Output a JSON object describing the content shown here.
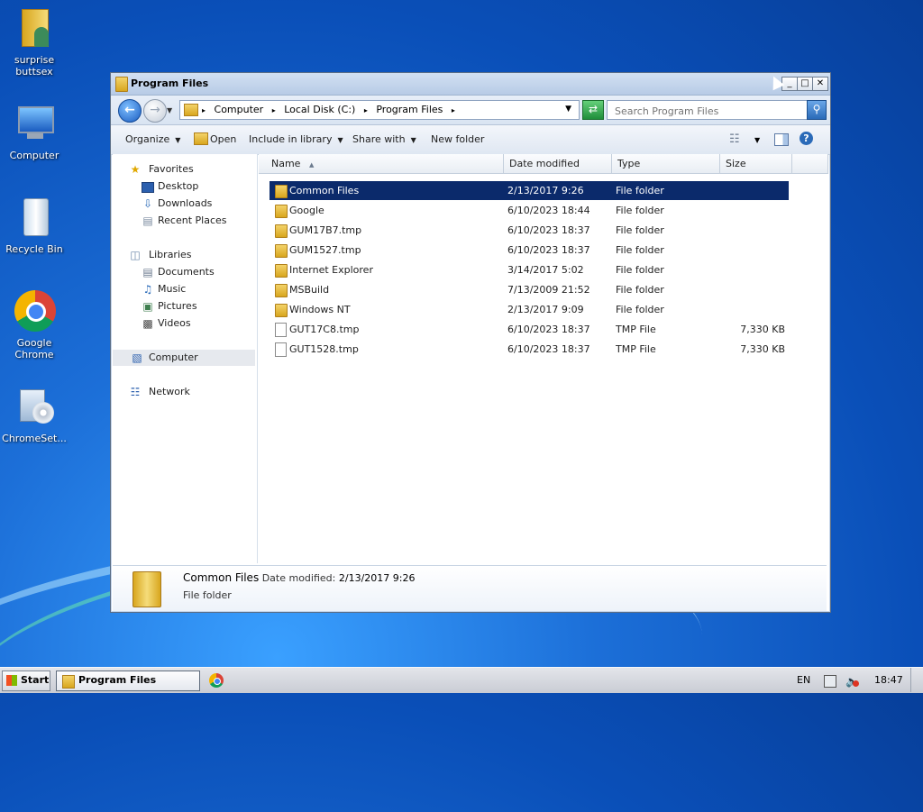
{
  "desktop": {
    "icons": [
      {
        "label": "surprise\nbuttsex",
        "icon": "user-folder-icon"
      },
      {
        "label": "Computer",
        "icon": "computer-icon"
      },
      {
        "label": "Recycle Bin",
        "icon": "recycle-bin-icon"
      },
      {
        "label": "Google Chrome",
        "icon": "chrome-icon"
      },
      {
        "label": "ChromeSet...",
        "icon": "installer-icon"
      }
    ]
  },
  "window": {
    "title": "Program Files",
    "controls": {
      "minimize": "_",
      "maximize": "□",
      "close": "✕"
    },
    "address": {
      "crumbs": [
        "Computer",
        "Local Disk (C:)",
        "Program Files"
      ],
      "search_placeholder": "Search Program Files"
    },
    "toolbar": {
      "organize": "Organize",
      "open": "Open",
      "include": "Include in library",
      "share": "Share with",
      "new_folder": "New folder"
    },
    "nav": {
      "favorites": "Favorites",
      "desktop": "Desktop",
      "downloads": "Downloads",
      "recent": "Recent Places",
      "libraries": "Libraries",
      "documents": "Documents",
      "music": "Music",
      "pictures": "Pictures",
      "videos": "Videos",
      "computer": "Computer",
      "network": "Network"
    },
    "columns": {
      "name": "Name",
      "date": "Date modified",
      "type": "Type",
      "size": "Size"
    },
    "files": [
      {
        "name": "Common Files",
        "date": "2/13/2017 9:26",
        "type": "File folder",
        "size": "",
        "kind": "folder",
        "selected": true
      },
      {
        "name": "Google",
        "date": "6/10/2023 18:44",
        "type": "File folder",
        "size": "",
        "kind": "folder"
      },
      {
        "name": "GUM17B7.tmp",
        "date": "6/10/2023 18:37",
        "type": "File folder",
        "size": "",
        "kind": "folder"
      },
      {
        "name": "GUM1527.tmp",
        "date": "6/10/2023 18:37",
        "type": "File folder",
        "size": "",
        "kind": "folder"
      },
      {
        "name": "Internet Explorer",
        "date": "3/14/2017 5:02",
        "type": "File folder",
        "size": "",
        "kind": "folder"
      },
      {
        "name": "MSBuild",
        "date": "7/13/2009 21:52",
        "type": "File folder",
        "size": "",
        "kind": "folder"
      },
      {
        "name": "Windows NT",
        "date": "2/13/2017 9:09",
        "type": "File folder",
        "size": "",
        "kind": "folder"
      },
      {
        "name": "GUT17C8.tmp",
        "date": "6/10/2023 18:37",
        "type": "TMP File",
        "size": "7,330 KB",
        "kind": "file"
      },
      {
        "name": "GUT1528.tmp",
        "date": "6/10/2023 18:37",
        "type": "TMP File",
        "size": "7,330 KB",
        "kind": "file"
      }
    ],
    "details": {
      "name": "Common Files",
      "date_label": "Date modified:",
      "date": "2/13/2017 9:26",
      "type": "File folder"
    }
  },
  "taskbar": {
    "start": "Start",
    "item": "Program Files",
    "lang": "EN",
    "time": "18:47"
  },
  "colors": {
    "selection": "#0b2a6b",
    "desktop": "#1c6fd8"
  }
}
